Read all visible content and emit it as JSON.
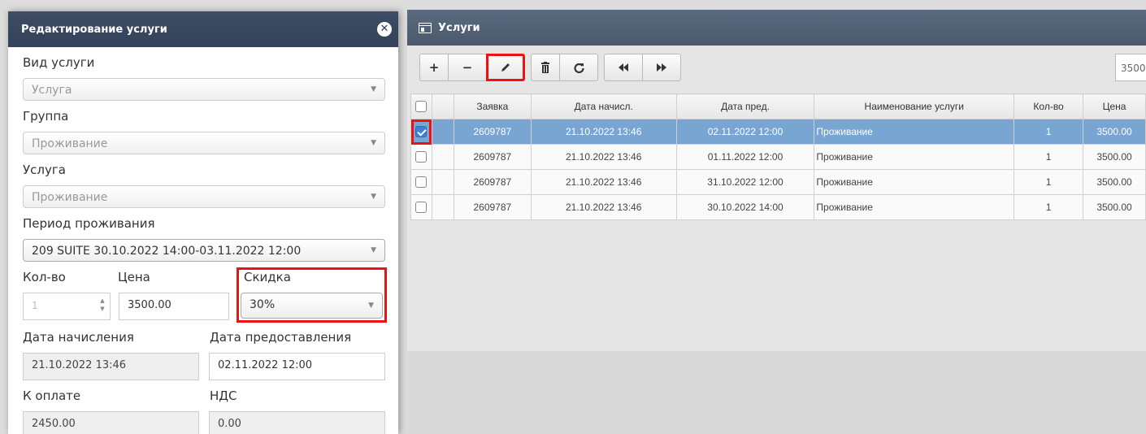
{
  "services_panel": {
    "title": "Услуги",
    "toolbar": {
      "add_label": "+",
      "remove_label": "−",
      "edit_icon": "pencil-icon",
      "delete_icon": "trash-icon",
      "refresh_icon": "refresh-icon",
      "first_icon": "double-left-icon",
      "last_icon": "double-right-icon"
    },
    "search_value": "3500",
    "columns": [
      "Заявка",
      "Дата начисл.",
      "Дата пред.",
      "Наименование услуги",
      "Кол-во",
      "Цена"
    ],
    "rows": [
      {
        "selected": true,
        "order": "2609787",
        "accrual": "21.10.2022 13:46",
        "provided": "02.11.2022 12:00",
        "name": "Проживание",
        "qty": "1",
        "price": "3500.00"
      },
      {
        "selected": false,
        "order": "2609787",
        "accrual": "21.10.2022 13:46",
        "provided": "01.11.2022 12:00",
        "name": "Проживание",
        "qty": "1",
        "price": "3500.00"
      },
      {
        "selected": false,
        "order": "2609787",
        "accrual": "21.10.2022 13:46",
        "provided": "31.10.2022 12:00",
        "name": "Проживание",
        "qty": "1",
        "price": "3500.00"
      },
      {
        "selected": false,
        "order": "2609787",
        "accrual": "21.10.2022 13:46",
        "provided": "30.10.2022 14:00",
        "name": "Проживание",
        "qty": "1",
        "price": "3500.00"
      }
    ]
  },
  "edit_panel": {
    "title": "Редактирование услуги",
    "service_type_label": "Вид услуги",
    "service_type_value": "Услуга",
    "group_label": "Группа",
    "group_value": "Проживание",
    "service_label": "Услуга",
    "service_value": "Проживание",
    "period_label": "Период проживания",
    "period_value": "209 SUITE 30.10.2022 14:00-03.11.2022 12:00",
    "qty_label": "Кол-во",
    "qty_value": "1",
    "price_label": "Цена",
    "price_value": "3500.00",
    "discount_label": "Скидка",
    "discount_value": "30%",
    "accrual_date_label": "Дата начисления",
    "accrual_date_value": "21.10.2022 13:46",
    "provided_date_label": "Дата предоставления",
    "provided_date_value": "02.11.2022 12:00",
    "to_pay_label": "К оплате",
    "to_pay_value": "2450.00",
    "vat_label": "НДС",
    "vat_value": "0.00"
  },
  "colors": {
    "header_dark": "#33415a",
    "header_grid": "#4a596c",
    "selected_row": "#79a5d3",
    "highlight": "#ee1111"
  }
}
